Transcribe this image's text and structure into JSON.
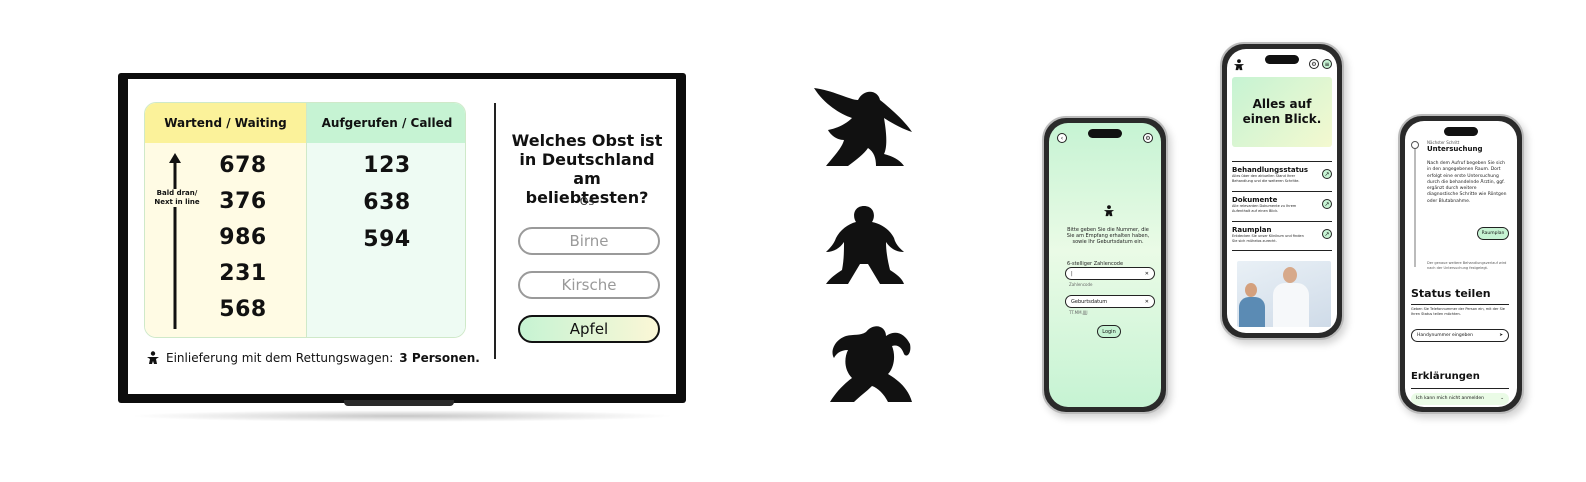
{
  "tv": {
    "waiting_header": "Wartend / Waiting",
    "called_header": "Aufgerufen / Called",
    "waiting_numbers": [
      "678",
      "376",
      "986",
      "231",
      "568"
    ],
    "called_numbers": [
      "123",
      "638",
      "594"
    ],
    "next_in_line_label": "Bald dran/ Next in line",
    "ambulance_text": "Einlieferung mit dem Rettungswagen:",
    "ambulance_count": "3 Personen.",
    "quiz_question": "Welches Obst ist in Deutschland am beliebtesten?",
    "quiz_sub": "Os",
    "answers": [
      "Birne",
      "Kirsche",
      "Apfel"
    ],
    "selected_answer": "Apfel"
  },
  "phone_login": {
    "instruction": "Bitte geben Sie die Nummer, die Sie am Empfang erhalten haben, sowie Ihr Geburtsdatum ein.",
    "code_label": "6-stelliger Zahlencode",
    "code_hint": "Zahlencode",
    "dob_placeholder": "Geburtsdatum",
    "dob_hint": "TT.MM.JJJJ",
    "login_button": "Login"
  },
  "phone_overview": {
    "hero_title": "Alles auf einen Blick.",
    "items": [
      {
        "title": "Behandlungsstatus",
        "desc": "Alles über den aktuellen Stand Ihrer Behandlung und die weiteren Schritte."
      },
      {
        "title": "Dokumente",
        "desc": "Alle relevanten Dokumente zu Ihrem Aufenthalt auf einen Blick."
      },
      {
        "title": "Raumplan",
        "desc": "Entdecken Sie unser Klinikum und finden Sie sich mühelos zurecht."
      }
    ]
  },
  "phone_status": {
    "next_step_label": "Nächster Schritt",
    "step_title": "Untersuchung",
    "step_text": "Nach dem Aufruf begeben Sie sich in den angegebenen Raum. Dort erfolgt eine erste Untersuchung durch die behandelnde Ärztin, ggf. ergänzt durch weitere diagnostische Schritte wie Röntgen oder Blutabnahme.",
    "room_button": "Raumplan",
    "footnote": "Der genaue weitere Behandlungsverlauf wird nach der Untersuchung festgelegt.",
    "share_title": "Status teilen",
    "share_text": "Geben Sie Telefonnummer der Person ein, mit der Sie Ihren Status teilen möchten.",
    "phone_input": "Handynummer eingeben",
    "explain_title": "Erklärungen",
    "explain_item": "Ich kann mich nicht anmelden"
  },
  "colors": {
    "yellow": "#fbf29a",
    "green": "#c6f3d3",
    "dark": "#111111"
  }
}
